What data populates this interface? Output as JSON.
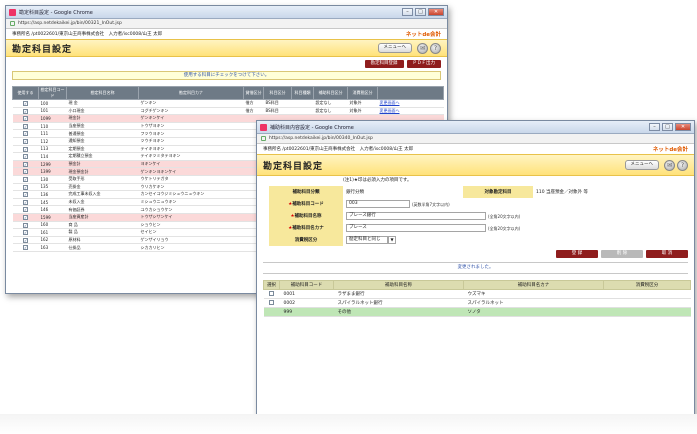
{
  "back_window": {
    "title": "勘定科目設定 - Google Chrome",
    "url": "https://asp.netdekaikei.jp/bin/00321_InOut.jsp",
    "office": "事務所名 /pt0022601/東京山王商事株式会社　入力者/isc0008/山王 太郎",
    "logo": "ネットde会計",
    "page_title": "勘定科目設定",
    "menu_label": "メニューへ",
    "mail_icon": "✉",
    "help_icon": "?",
    "btn_register": "勘定科目登録",
    "btn_pdf": "ＰＤＦ出力",
    "notice": "使用する科目にチェックをつけて下さい。",
    "columns": [
      "使用する",
      "勘定科目コード",
      "勘定科目名称",
      "勘定科目カナ",
      "貸借区分",
      "科目区分",
      "科目種類",
      "補助科目区分",
      "消費税区分"
    ],
    "rows": [
      {
        "code": "100",
        "name": "現 金",
        "kana": "ゲンキン",
        "dc": "借方",
        "cat": "BS科目",
        "kind": "",
        "sub": "設定なし",
        "tax": "対象外",
        "link": "変更画面へ",
        "pink": false
      },
      {
        "code": "101",
        "name": "小口現金",
        "kana": "コグチゲンキン",
        "dc": "借方",
        "cat": "BS科目",
        "kind": "",
        "sub": "設定なし",
        "tax": "対象外",
        "link": "変更画面へ",
        "pink": false
      },
      {
        "code": "1099",
        "name": "現金計",
        "kana": "ゲンキンケイ",
        "dc": "",
        "cat": "",
        "kind": "",
        "sub": "",
        "tax": "",
        "link": "",
        "pink": true
      },
      {
        "code": "110",
        "name": "当座預金",
        "kana": "トウザヨキン",
        "dc": "",
        "cat": "",
        "kind": "",
        "sub": "",
        "tax": "",
        "link": "",
        "pink": false
      },
      {
        "code": "111",
        "name": "普通預金",
        "kana": "フツウヨキン",
        "dc": "",
        "cat": "",
        "kind": "",
        "sub": "",
        "tax": "",
        "link": "",
        "pink": false
      },
      {
        "code": "112",
        "name": "通知預金",
        "kana": "ツウチヨキン",
        "dc": "",
        "cat": "",
        "kind": "",
        "sub": "",
        "tax": "",
        "link": "",
        "pink": false
      },
      {
        "code": "113",
        "name": "定期預金",
        "kana": "テイキヨキン",
        "dc": "",
        "cat": "",
        "kind": "",
        "sub": "",
        "tax": "",
        "link": "",
        "pink": false
      },
      {
        "code": "114",
        "name": "定期積立預金",
        "kana": "テイキツミタテヨキン",
        "dc": "",
        "cat": "",
        "kind": "",
        "sub": "",
        "tax": "",
        "link": "",
        "pink": false
      },
      {
        "code": "1299",
        "name": "預金計",
        "kana": "ヨキンケイ",
        "dc": "",
        "cat": "",
        "kind": "",
        "sub": "",
        "tax": "",
        "link": "",
        "pink": true
      },
      {
        "code": "1399",
        "name": "現金預金計",
        "kana": "ゲンキンヨキンケイ",
        "dc": "",
        "cat": "",
        "kind": "",
        "sub": "",
        "tax": "",
        "link": "",
        "pink": true
      },
      {
        "code": "130",
        "name": "受取手形",
        "kana": "ウケトリテガタ",
        "dc": "",
        "cat": "",
        "kind": "",
        "sub": "",
        "tax": "",
        "link": "",
        "pink": false
      },
      {
        "code": "135",
        "name": "売掛金",
        "kana": "ウリカケキン",
        "dc": "",
        "cat": "",
        "kind": "",
        "sub": "",
        "tax": "",
        "link": "",
        "pink": false
      },
      {
        "code": "136",
        "name": "完成工事未収入金",
        "kana": "カンセイコウジミシュウニュウキン",
        "dc": "",
        "cat": "",
        "kind": "",
        "sub": "",
        "tax": "",
        "link": "",
        "pink": false
      },
      {
        "code": "145",
        "name": "未収入金",
        "kana": "ミシュウニュウキン",
        "dc": "",
        "cat": "",
        "kind": "",
        "sub": "",
        "tax": "",
        "link": "",
        "pink": false
      },
      {
        "code": "146",
        "name": "有価証券",
        "kana": "ユウカショウケン",
        "dc": "",
        "cat": "",
        "kind": "",
        "sub": "",
        "tax": "",
        "link": "",
        "pink": false
      },
      {
        "code": "1599",
        "name": "当座資産計",
        "kana": "トウザシサンケイ",
        "dc": "",
        "cat": "",
        "kind": "",
        "sub": "",
        "tax": "",
        "link": "",
        "pink": true
      },
      {
        "code": "160",
        "name": "商 品",
        "kana": "ショウヒン",
        "dc": "",
        "cat": "",
        "kind": "",
        "sub": "",
        "tax": "",
        "link": "",
        "pink": false
      },
      {
        "code": "161",
        "name": "製 品",
        "kana": "セイヒン",
        "dc": "",
        "cat": "",
        "kind": "",
        "sub": "",
        "tax": "",
        "link": "",
        "pink": false
      },
      {
        "code": "162",
        "name": "原材料",
        "kana": "ゲンザイリョウ",
        "dc": "",
        "cat": "",
        "kind": "",
        "sub": "",
        "tax": "",
        "link": "",
        "pink": false
      },
      {
        "code": "163",
        "name": "仕掛品",
        "kana": "シカカリヒン",
        "dc": "",
        "cat": "",
        "kind": "",
        "sub": "",
        "tax": "",
        "link": "",
        "pink": false
      }
    ]
  },
  "front_window": {
    "title": "補助科目内容設定 - Google Chrome",
    "url": "https://asp.netdekaikei.jp/bin/00340_InOut.jsp",
    "office": "事務所名 /pt0022601/東京山王商事株式会社　入力者/isc0008/山王 太郎",
    "logo": "ネットde会計",
    "page_title": "勘定科目設定",
    "menu_label": "メニューへ",
    "mail_icon": "✉",
    "help_icon": "?",
    "note": "(注1)★印は必須入力の項目です。",
    "form": {
      "kind_label": "補助科目分類",
      "kind_value": "銀行分類",
      "target_label": "対象勘定科目",
      "target_value": "110 当座預金／対象外 等",
      "code_label": "補助科目コード",
      "code_value": "003",
      "code_hint": "(英数半角7文字以内)",
      "name_label": "補助科目名称",
      "name_value": "プレース銀行",
      "name_hint": "(全角20文字以内)",
      "kana_label": "補助科目名カナ",
      "kana_value": "プレース",
      "kana_hint": "(全角20文字以内)",
      "tax_label": "消費税区分",
      "tax_value": "勘定科目と同じ",
      "req_mark": "★"
    },
    "btn_register": "登 録",
    "btn_delete": "削 除",
    "btn_cancel": "取 消",
    "message": "変更されました。",
    "columns": [
      "選択",
      "補助科目コード",
      "補助科目名称",
      "補助科目名カナ",
      "消費税区分"
    ],
    "rows": [
      {
        "code": "0001",
        "name": "ラザまま銀行",
        "kana": "ウズマキ",
        "tax": "",
        "green": false,
        "check": true
      },
      {
        "code": "0002",
        "name": "スパイラルネット銀行",
        "kana": "スパイラルネット",
        "tax": "",
        "green": false,
        "check": true
      },
      {
        "code": "999",
        "name": "その他",
        "kana": "ソノタ",
        "tax": "",
        "green": true,
        "check": false
      }
    ]
  }
}
